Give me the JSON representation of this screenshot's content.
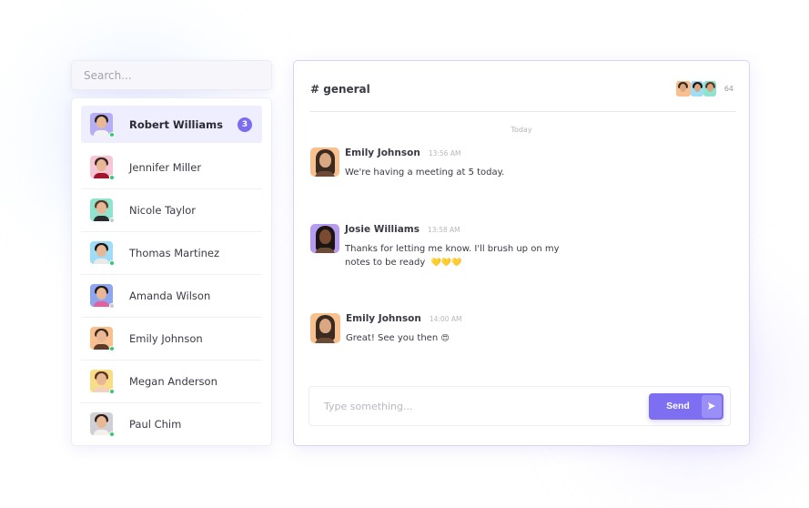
{
  "search": {
    "placeholder": "Search..."
  },
  "contacts": [
    {
      "name": "Robert Williams",
      "status": "online",
      "unread": "3",
      "active": true,
      "avatar_bg": "#b5aef5",
      "hair": "#2a211c",
      "shirt": "#f2f2f2"
    },
    {
      "name": "Jennifer Miller",
      "status": "online",
      "unread": "",
      "active": false,
      "avatar_bg": "#f7c6d6",
      "hair": "#3a2620",
      "shirt": "#a0162a"
    },
    {
      "name": "Nicole Taylor",
      "status": "offline",
      "unread": "",
      "active": false,
      "avatar_bg": "#8fe3cf",
      "hair": "#5a3a26",
      "shirt": "#2b2b2b"
    },
    {
      "name": "Thomas Martinez",
      "status": "online",
      "unread": "",
      "active": false,
      "avatar_bg": "#9fdcf5",
      "hair": "#1f1714",
      "shirt": "#e9e9e9"
    },
    {
      "name": "Amanda Wilson",
      "status": "offline",
      "unread": "",
      "active": false,
      "avatar_bg": "#8ea6f0",
      "hair": "#241a16",
      "shirt": "#e25fa0"
    },
    {
      "name": "Emily Johnson",
      "status": "online",
      "unread": "",
      "active": false,
      "avatar_bg": "#f8c08e",
      "hair": "#3b2a20",
      "shirt": "#5c3b2a"
    },
    {
      "name": "Megan Anderson",
      "status": "online",
      "unread": "",
      "active": false,
      "avatar_bg": "#f9dc86",
      "hair": "#5a3420",
      "shirt": "#f3d0c0"
    },
    {
      "name": "Paul Chim",
      "status": "online",
      "unread": "",
      "active": false,
      "avatar_bg": "#cfcfd4",
      "hair": "#2a1f1a",
      "shirt": "#f4f1ea"
    }
  ],
  "chat": {
    "channel": "# general",
    "member_count": "64",
    "member_avatars": [
      {
        "bg": "#f8c08e",
        "hair": "#3b2a20"
      },
      {
        "bg": "#9fdcf5",
        "hair": "#1f1714"
      },
      {
        "bg": "#8fe3cf",
        "hair": "#5a3a26"
      }
    ],
    "date_separator": "Today",
    "messages": [
      {
        "author": "Emily Johnson",
        "time": "13:56 AM",
        "text": "We're having a meeting at 5 today.",
        "emoji": "",
        "avatar_bg": "#f8c08e",
        "hair": "#3b2a20",
        "skin": "#d9a882"
      },
      {
        "author": "Josie Williams",
        "time": "13:58 AM",
        "text": "Thanks for letting me know. I'll brush up on my notes to be ready",
        "emoji": "💛💛💛",
        "avatar_bg": "#b59cf0",
        "hair": "#1c1512",
        "skin": "#7a4a32"
      },
      {
        "author": "Emily Johnson",
        "time": "14:00 AM",
        "text": "Great! See you then",
        "emoji": "😍",
        "avatar_bg": "#f8c08e",
        "hair": "#3b2a20",
        "skin": "#d9a882"
      }
    ],
    "composer": {
      "placeholder": "Type something...",
      "value": "",
      "send_label": "Send"
    }
  },
  "colors": {
    "accent": "#7e6ff2",
    "online": "#2ecc71",
    "offline": "#c8c8cf",
    "active_row": "#efeefe"
  }
}
